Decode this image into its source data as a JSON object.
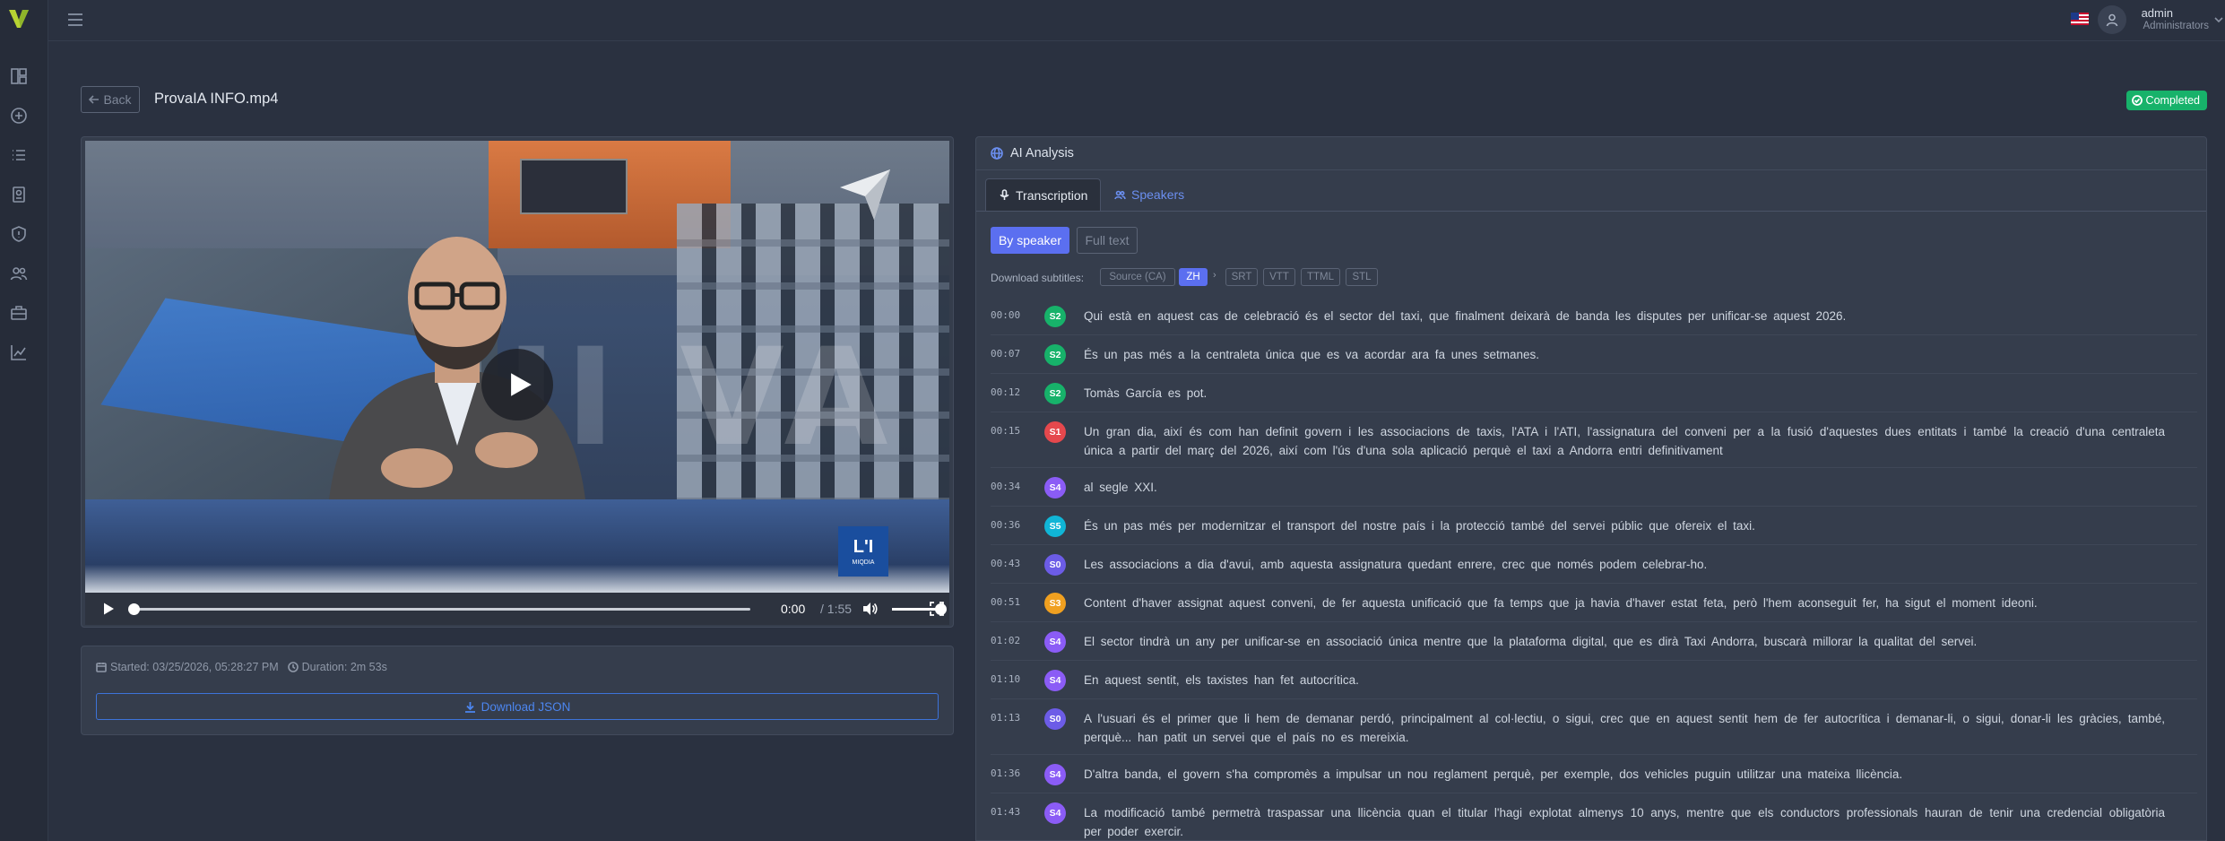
{
  "app": {
    "brand_letter": "V"
  },
  "colors": {
    "accent": "#5b6ff0",
    "success": "#17b26a",
    "link": "#4c86f0",
    "speaker_S0": "#6c5ce7",
    "speaker_S1": "#e5484d",
    "speaker_S2": "#17b26a",
    "speaker_S3": "#f0a020",
    "speaker_S4": "#8b5cf6",
    "speaker_S5": "#10b5d6"
  },
  "sidebar": {
    "icons": [
      "dashboard-icon",
      "add-circle-icon",
      "list-icon",
      "badge-icon",
      "shield-icon",
      "users-icon",
      "briefcase-icon",
      "chart-icon"
    ]
  },
  "topbar": {
    "user_name": "admin",
    "user_role": "Administrators",
    "flag": "us-flag-icon"
  },
  "header": {
    "back_label": "Back",
    "file_title": "ProvaIA INFO.mp4",
    "status": "Completed"
  },
  "video": {
    "watermark": "HI VA",
    "logo_main": "L'I",
    "logo_sub": "MIQDIA",
    "time_current": "0:00",
    "time_total": "/ 1:55",
    "progress": 0,
    "volume": 1.0
  },
  "info": {
    "started": "Started: 03/25/2026, 05:28:27 PM",
    "duration": "Duration: 2m 53s",
    "download_json": "Download JSON"
  },
  "ai": {
    "title": "AI Analysis",
    "tabs": [
      "Transcription",
      "Speakers"
    ],
    "view_modes": [
      "By speaker",
      "Full text"
    ],
    "subtitles_label": "Download subtitles:",
    "lang_chips": [
      "Source (CA)",
      "ZH"
    ],
    "lang_sep": "›",
    "format_chips": [
      "SRT",
      "VTT",
      "TTML",
      "STL"
    ],
    "segments": [
      {
        "time": "00:00",
        "speaker": "S2",
        "text": "Qui està en aquest cas de celebració és el sector del taxi, que finalment deixarà de banda les disputes per unificar-se aquest 2026."
      },
      {
        "time": "00:07",
        "speaker": "S2",
        "text": "És un pas més a la centraleta única que es va acordar ara fa unes setmanes."
      },
      {
        "time": "00:12",
        "speaker": "S2",
        "text": "Tomàs García es pot."
      },
      {
        "time": "00:15",
        "speaker": "S1",
        "text": "Un gran dia, així és com han definit govern i les associacions de taxis, l'ATA i l'ATI, l'assignatura del conveni per a la fusió d'aquestes dues entitats i també la creació d'una centraleta única a partir del març del 2026, així com l'ús d'una sola aplicació perquè el taxi a Andorra entri definitivament"
      },
      {
        "time": "00:34",
        "speaker": "S4",
        "text": "al segle XXI."
      },
      {
        "time": "00:36",
        "speaker": "S5",
        "text": "És un pas més per modernitzar el transport del nostre país i la protecció també del servei públic que ofereix el taxi."
      },
      {
        "time": "00:43",
        "speaker": "S0",
        "text": "Les associacions a dia d'avui, amb aquesta assignatura quedant enrere, crec que només podem celebrar-ho."
      },
      {
        "time": "00:51",
        "speaker": "S3",
        "text": "Content d'haver assignat aquest conveni, de fer aquesta unificació que fa temps que ja havia d'haver estat feta, però l'hem aconseguit fer, ha sigut el moment ideoni."
      },
      {
        "time": "01:02",
        "speaker": "S4",
        "text": "El sector tindrà un any per unificar-se en associació única mentre que la plataforma digital, que es dirà Taxi Andorra, buscarà millorar la qualitat del servei."
      },
      {
        "time": "01:10",
        "speaker": "S4",
        "text": "En aquest sentit, els taxistes han fet autocrítica."
      },
      {
        "time": "01:13",
        "speaker": "S0",
        "text": "A l'usuari és el primer que li hem de demanar perdó, principalment al col·lectiu, o sigui, crec que en aquest sentit hem de fer autocrítica i demanar-li, o sigui, donar-li les gràcies, també, perquè... han patit un servei que el país no es mereixia."
      },
      {
        "time": "01:36",
        "speaker": "S4",
        "text": "D'altra banda, el govern s'ha compromès a impulsar un nou reglament perquè, per exemple, dos vehicles puguin utilitzar una mateixa llicència."
      },
      {
        "time": "01:43",
        "speaker": "S4",
        "text": "La modificació també permetrà traspassar una llicència quan el titular l'hagi explotat almenys 10 anys, mentre que els conductors professionals hauran de tenir una credencial obligatòria per poder exercir."
      }
    ]
  }
}
